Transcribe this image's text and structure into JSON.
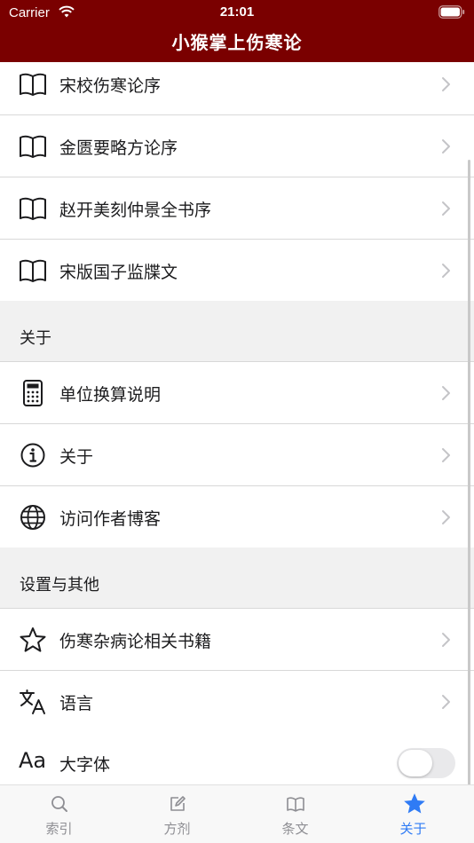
{
  "status_bar": {
    "carrier": "Carrier",
    "time": "21:01"
  },
  "nav": {
    "title": "小猴掌上伤寒论"
  },
  "rows_top": [
    {
      "label": "宋校伤寒论序",
      "icon": "book-icon"
    },
    {
      "label": "金匮要略方论序",
      "icon": "book-icon"
    },
    {
      "label": "赵开美刻仲景全书序",
      "icon": "book-icon"
    },
    {
      "label": "宋版国子监牒文",
      "icon": "book-icon"
    }
  ],
  "section_about": {
    "label": "关于"
  },
  "rows_about": [
    {
      "label": "单位换算说明",
      "icon": "calculator-icon"
    },
    {
      "label": "关于",
      "icon": "info-icon"
    },
    {
      "label": "访问作者博客",
      "icon": "globe-icon"
    }
  ],
  "section_settings": {
    "label": "设置与其他"
  },
  "rows_settings": [
    {
      "label": "伤寒杂病论相关书籍",
      "icon": "star-outline-icon"
    },
    {
      "label": "语言",
      "icon": "translate-icon"
    }
  ],
  "large_font": {
    "icon_text": "Aa",
    "label": "大字体",
    "enabled": false
  },
  "tabs": [
    {
      "label": "索引",
      "icon": "search-icon",
      "active": false
    },
    {
      "label": "方剂",
      "icon": "edit-icon",
      "active": false
    },
    {
      "label": "条文",
      "icon": "book-icon",
      "active": false
    },
    {
      "label": "关于",
      "icon": "star-icon",
      "active": true
    }
  ],
  "colors": {
    "nav_background": "#7a0000",
    "tab_active": "#2f7bf5",
    "tab_inactive": "#8e8e93",
    "section_background": "#f1f1f1"
  }
}
